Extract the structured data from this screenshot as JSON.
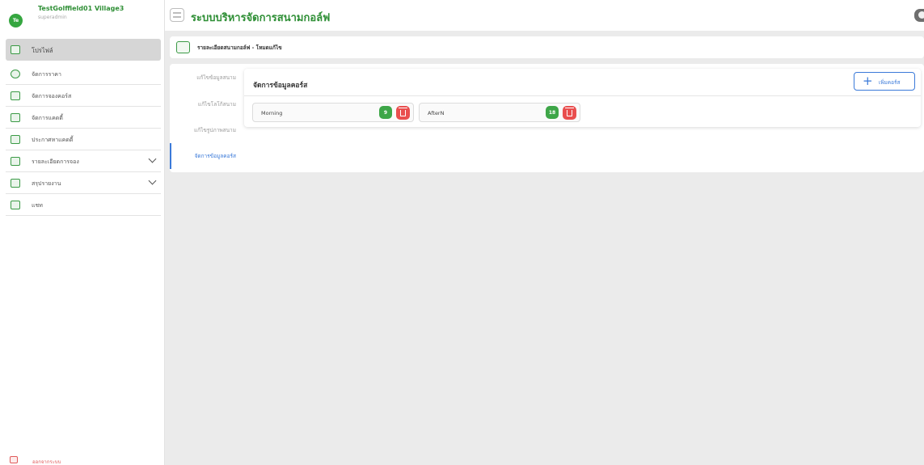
{
  "user": {
    "initials": "Te",
    "name": "TestGolffield01 Village3",
    "role": "superadmin"
  },
  "sidebar": {
    "items": [
      {
        "label": "โปรไฟล์",
        "icon": "profile-card-icon"
      },
      {
        "label": "จัดการราคา",
        "icon": "dollar-icon"
      },
      {
        "label": "จัดการจองคอร์ส",
        "icon": "chart-icon"
      },
      {
        "label": "จัดการแคดดี้",
        "icon": "group-icon"
      },
      {
        "label": "ประกาศหาแคดดี้",
        "icon": "megaphone-icon"
      },
      {
        "label": "รายละเอียดการจอง",
        "icon": "list-icon"
      },
      {
        "label": "สรุปรายงาน",
        "icon": "report-icon"
      },
      {
        "label": "แชท",
        "icon": "chat-icon"
      }
    ],
    "logout_label": "ออกจากระบบ"
  },
  "header": {
    "title": "ระบบบริหารจัดการสนามกอล์ฟ"
  },
  "breadcrumb": {
    "text": "รายละเอียดสนามกอล์ฟ - โหมดแก้ไข"
  },
  "tabs": [
    "แก้ไขข้อมูลสนาม",
    "แก้ไขโลโก้สนาม",
    "แก้ไขรูปภาพสนาม",
    "จัดการข้อมูลคอร์ส"
  ],
  "course_panel": {
    "title": "จัดการข้อมูลคอร์ส",
    "add_label": "เพิ่มคอร์ส",
    "courses": [
      {
        "name": "Morning",
        "count": "9"
      },
      {
        "name": "AfterN",
        "count": "18"
      }
    ]
  },
  "colors": {
    "brand_green": "#2f8f36",
    "accent_blue": "#3b7ad9",
    "danger_red": "#e94e4e"
  }
}
